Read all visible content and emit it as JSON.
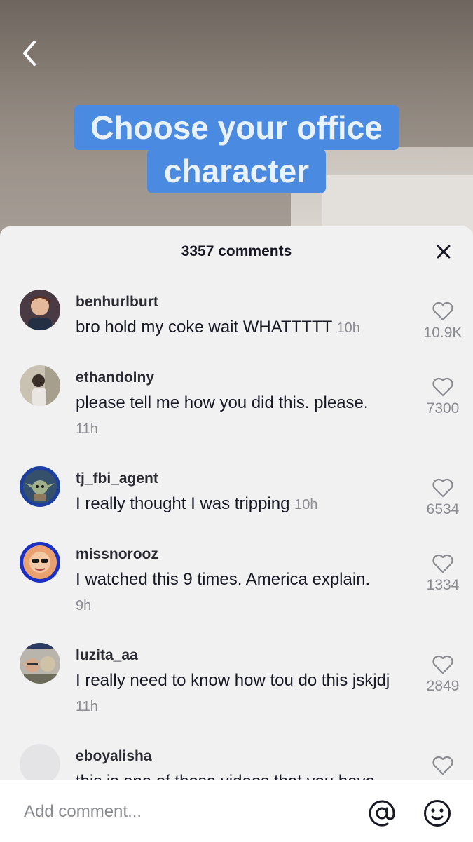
{
  "video": {
    "caption_line1": "Choose your office",
    "caption_line2": "character",
    "caption_bg": "#4a8ae0"
  },
  "comments_panel": {
    "title": "3357 comments",
    "close_icon": "close-icon"
  },
  "comments": [
    {
      "username": "benhurlburt",
      "text": "bro hold my coke wait WHATTTTT",
      "time": "10h",
      "likes": "10.9K"
    },
    {
      "username": "ethandolny",
      "text": "please tell me how you did this. please.",
      "time": "11h",
      "likes": "7300"
    },
    {
      "username": "tj_fbi_agent",
      "text": "I really thought I was tripping",
      "time": "10h",
      "likes": "6534"
    },
    {
      "username": "missnorooz",
      "text": "I watched this 9 times. America explain.",
      "time": "9h",
      "likes": "1334"
    },
    {
      "username": "luzita_aa",
      "text": "I really need to know how tou do this jskjdj",
      "time": "11h",
      "likes": "2849"
    },
    {
      "username": "eboyalisha",
      "text": "this is one of those videos that you have",
      "time": "",
      "likes": ""
    }
  ],
  "bottom_bar": {
    "placeholder": "Add comment...",
    "mention_icon": "at-sign-icon",
    "emoji_icon": "smiley-icon"
  }
}
